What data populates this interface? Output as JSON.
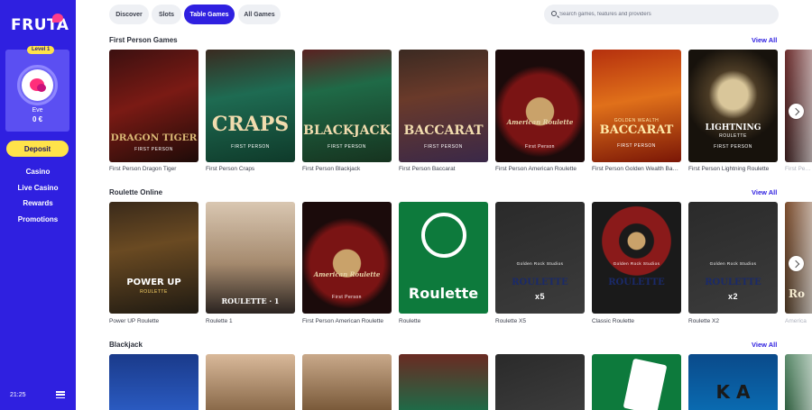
{
  "app": {
    "logo": "FRUTA"
  },
  "profile": {
    "level": "Level 1",
    "user": "Eve",
    "balance": "0 €",
    "avatar_icon": "fruit-avatar-icon"
  },
  "sidebar": {
    "deposit_label": "Deposit",
    "items": [
      {
        "label": "Casino"
      },
      {
        "label": "Live Casino"
      },
      {
        "label": "Rewards"
      },
      {
        "label": "Promotions"
      }
    ],
    "time": "21:25",
    "menu_icon": "hamburger-menu-icon"
  },
  "filters": [
    {
      "label": "Discover",
      "active": false
    },
    {
      "label": "Slots",
      "active": false
    },
    {
      "label": "Table Games",
      "active": true
    },
    {
      "label": "All Games",
      "active": false
    }
  ],
  "search": {
    "placeholder": "Search games, features and providers",
    "icon": "search-icon"
  },
  "colors": {
    "accent": "#2f20e0",
    "deposit": "#ffe34a",
    "link": "#2f20e0"
  },
  "sections": [
    {
      "title": "First Person Games",
      "view_all": "View All",
      "games": [
        {
          "name": "First Person Dragon Tiger",
          "art_title": "DRAGON TIGER",
          "art_sub": "FIRST PERSON"
        },
        {
          "name": "First Person Craps",
          "art_title": "CRAPS",
          "art_sub": "FIRST PERSON"
        },
        {
          "name": "First Person Blackjack",
          "art_title": "BLACKJACK",
          "art_sub": "FIRST PERSON"
        },
        {
          "name": "First Person Baccarat",
          "art_title": "BACCARAT",
          "art_sub": "FIRST PERSON"
        },
        {
          "name": "First Person American Roulette",
          "art_title": "American Roulette",
          "art_sub": "First Person"
        },
        {
          "name": "First Person Golden Wealth Baccarat",
          "art_title": "BACCARAT",
          "art_sub": "FIRST PERSON",
          "art_top": "GOLDEN WEALTH"
        },
        {
          "name": "First Person Lightning Roulette",
          "art_title": "LIGHTNING",
          "art_sub": "FIRST PERSON",
          "art_top": "ROULETTE"
        },
        {
          "name": "First Person",
          "art_title": "",
          "art_sub": ""
        }
      ]
    },
    {
      "title": "Roulette Online",
      "view_all": "View All",
      "games": [
        {
          "name": "Power UP Roulette",
          "art_title": "POWER UP",
          "art_sub": "ROULETTE"
        },
        {
          "name": "Roulette 1",
          "art_title": "ROULETTE · 1",
          "art_sub": ""
        },
        {
          "name": "First Person American Roulette",
          "art_title": "American Roulette",
          "art_sub": "First Person"
        },
        {
          "name": "Roulette",
          "art_title": "Roulette",
          "art_sub": ""
        },
        {
          "name": "Roulette X5",
          "art_title": "ROULETTE",
          "art_sub": "x5",
          "art_badge": "Golden Rock Studios"
        },
        {
          "name": "Classic Roulette",
          "art_title": "ROULETTE",
          "art_sub": "",
          "art_badge": "Golden Rock Studios"
        },
        {
          "name": "Roulette X2",
          "art_title": "ROULETTE",
          "art_sub": "x2",
          "art_badge": "Golden Rock Studios"
        },
        {
          "name": "America",
          "art_title": "Ro",
          "art_sub": ""
        }
      ]
    },
    {
      "title": "Blackjack",
      "view_all": "View All",
      "games": [
        {
          "name": "",
          "art_title": "",
          "art_sub": ""
        },
        {
          "name": "",
          "art_title": "",
          "art_sub": ""
        },
        {
          "name": "",
          "art_title": "",
          "art_sub": ""
        },
        {
          "name": "",
          "art_title": "",
          "art_sub": ""
        },
        {
          "name": "",
          "art_title": "",
          "art_sub": ""
        },
        {
          "name": "",
          "art_title": "",
          "art_sub": ""
        },
        {
          "name": "",
          "art_title": "K A",
          "art_sub": ""
        },
        {
          "name": "",
          "art_title": "",
          "art_sub": ""
        }
      ]
    }
  ]
}
